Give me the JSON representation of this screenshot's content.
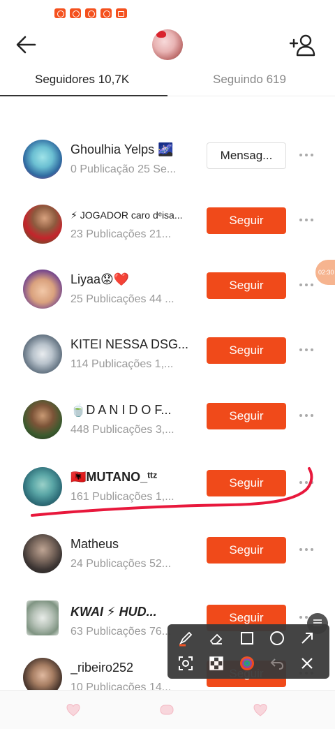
{
  "header": {
    "back_icon": "arrow-left-icon",
    "add_user_icon": "add-user-icon"
  },
  "tabs": [
    {
      "label": "Seguidores 10,7K"
    },
    {
      "label": "Seguindo 619"
    }
  ],
  "colors": {
    "accent": "#f04a1a",
    "annotation": "#e8183c"
  },
  "followers": [
    {
      "name": "Ghoulhia Yelps 🌌",
      "meta": "0 Publicação   25 Se...",
      "action": "Mensag..."
    },
    {
      "name": "⚡ JOGADOR caro dᵉisa...",
      "meta": "23 Publicações   21...",
      "action": "Seguir"
    },
    {
      "name": "Liyaa😟❤️",
      "meta": "25 Publicações   44 ...",
      "action": "Seguir"
    },
    {
      "name": "KITEI NESSA DSG...",
      "meta": "114 Publicações   1,...",
      "action": "Seguir"
    },
    {
      "name": "🍵D A N I  D O F...",
      "meta": "448 Publicações   3,...",
      "action": "Seguir"
    },
    {
      "name": "🇦🇱MUTANO_ᵗᵗᶻ",
      "meta": "161 Publicações   1,...",
      "action": "Seguir"
    },
    {
      "name": "Matheus",
      "meta": "24 Publicações   52...",
      "action": "Seguir"
    },
    {
      "name": "KWAI ⚡ HUD...",
      "meta": "63 Publicações   76...",
      "action": "Seguir"
    },
    {
      "name": "_ribeiro252",
      "meta": "10 Publicações   14...",
      "action": "Seguir"
    }
  ],
  "timer": "02:30",
  "toolbar": {
    "tools": [
      "pen-icon",
      "eraser-icon",
      "square-icon",
      "circle-icon",
      "arrow-icon",
      "screenshot-icon",
      "mosaic-icon",
      "color-icon",
      "undo-icon",
      "close-icon"
    ]
  }
}
